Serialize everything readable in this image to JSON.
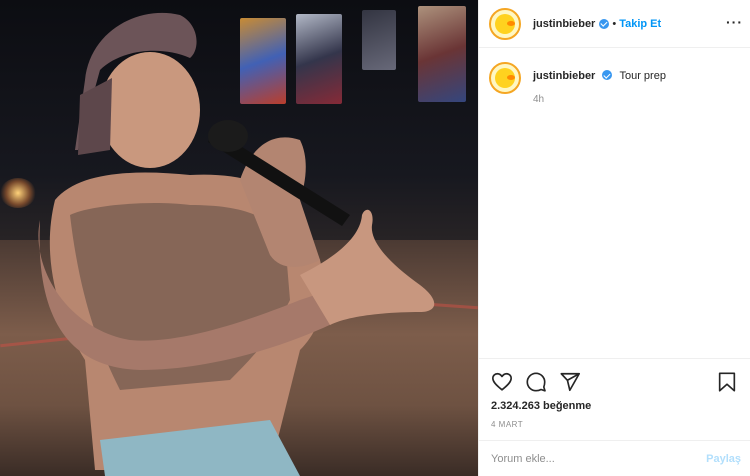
{
  "post": {
    "image_alt": "",
    "header": {
      "username": "justinbieber",
      "separator": "•",
      "follow_label": "Takip Et",
      "more_label": "···"
    },
    "caption": {
      "username": "justinbieber",
      "text": "Tour prep",
      "time_ago": "4h"
    },
    "actions": {
      "like_icon": "heart-icon",
      "comment_icon": "comment-icon",
      "share_icon": "send-icon",
      "save_icon": "bookmark-icon"
    },
    "likes_text": "2.324.263 beğenme",
    "date": "4 MART",
    "comment": {
      "placeholder": "Yorum ekle...",
      "value": "",
      "submit_label": "Paylaş"
    }
  },
  "colors": {
    "accent": "#0095f6",
    "verified": "#3897f0",
    "muted": "#8e8e8e",
    "submit_disabled": "#b2dffc"
  }
}
